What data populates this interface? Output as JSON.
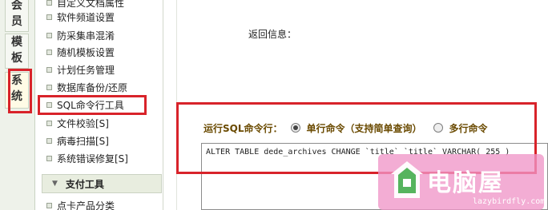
{
  "vertical_tabs": [
    {
      "label": "会员",
      "chars": [
        "会",
        "员"
      ]
    },
    {
      "label": "模板",
      "chars": [
        "模",
        "板"
      ]
    },
    {
      "label": "系统",
      "chars": [
        "系",
        "统"
      ]
    }
  ],
  "menu": {
    "items": [
      {
        "label": "自定义文档属性"
      },
      {
        "label": "软件频道设置"
      },
      {
        "label": "防采集串混淆"
      },
      {
        "label": "随机模板设置"
      },
      {
        "label": "计划任务管理"
      },
      {
        "label": "数据库备份/还原"
      },
      {
        "label": "SQL命令行工具"
      },
      {
        "label": "文件校验[S]"
      },
      {
        "label": "病毒扫描[S]"
      },
      {
        "label": "系统错误修复[S]"
      }
    ],
    "section": {
      "label": "支付工具"
    },
    "after_section": [
      {
        "label": "点卡产品分类"
      }
    ]
  },
  "main": {
    "return_label": "返回信息：",
    "run_label": "运行SQL命令行：",
    "mode_single": "单行命令（支持简单查询）",
    "mode_multi": "多行命令",
    "selected_mode": "single",
    "sql_text": "ALTER TABLE dede_archives CHANGE `title` `title` VARCHAR( 255 )"
  },
  "watermark": {
    "text": "电脑屋",
    "url": "lazybirdfly.com"
  },
  "colors": {
    "highlight_red": "#d8232a",
    "label_brown": "#6a4a00",
    "watermark_pink": "#f096c8"
  }
}
